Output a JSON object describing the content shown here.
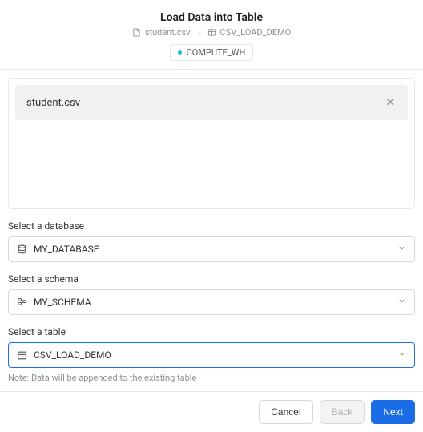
{
  "header": {
    "title": "Load Data into Table",
    "source_file": "student.csv",
    "target_table": "CSV_LOAD_DEMO",
    "compute_label": "COMPUTE_WH"
  },
  "file_panel": {
    "file_name": "student.csv"
  },
  "fields": {
    "database": {
      "label": "Select a database",
      "value": "MY_DATABASE"
    },
    "schema": {
      "label": "Select a schema",
      "value": "MY_SCHEMA"
    },
    "table": {
      "label": "Select a table",
      "value": "CSV_LOAD_DEMO",
      "note": "Note: Data will be appended to the existing table"
    }
  },
  "footer": {
    "cancel": "Cancel",
    "back": "Back",
    "next": "Next"
  }
}
